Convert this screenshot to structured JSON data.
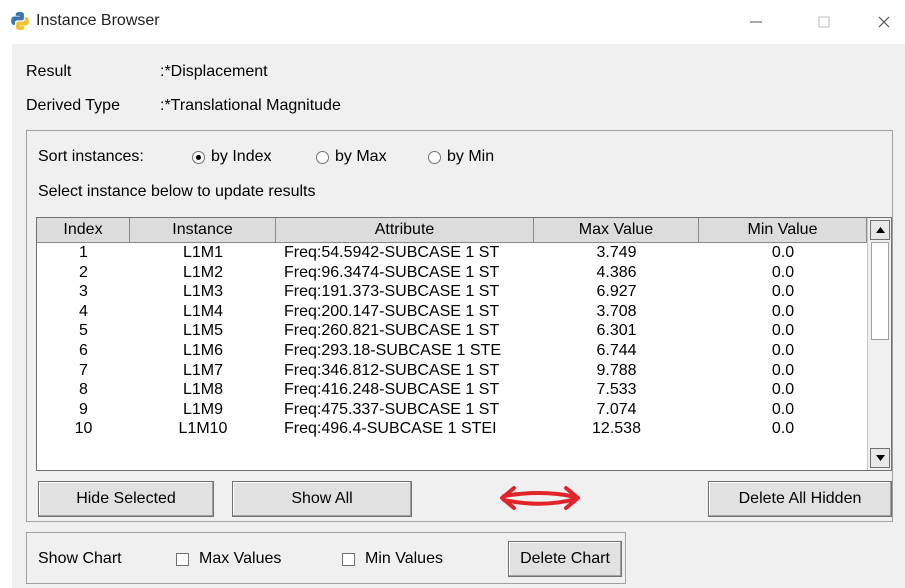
{
  "window": {
    "title": "Instance Browser",
    "icon": "python-icon"
  },
  "info": {
    "result_label": "Result",
    "result_value": ":*Displacement",
    "derived_label": "Derived Type",
    "derived_value": ":*Translational Magnitude"
  },
  "sort": {
    "label": "Sort instances:",
    "options": [
      "by Index",
      "by Max",
      "by Min"
    ],
    "selected": "by Index",
    "hint": "Select instance below to update results"
  },
  "table": {
    "columns": [
      "Index",
      "Instance",
      "Attribute",
      "Max Value",
      "Min Value"
    ],
    "rows": [
      [
        "1",
        "L1M1",
        "Freq:54.5942-SUBCASE 1 ST",
        "3.749",
        "0.0"
      ],
      [
        "2",
        "L1M2",
        "Freq:96.3474-SUBCASE 1 ST",
        "4.386",
        "0.0"
      ],
      [
        "3",
        "L1M3",
        "Freq:191.373-SUBCASE 1 ST",
        "6.927",
        "0.0"
      ],
      [
        "4",
        "L1M4",
        "Freq:200.147-SUBCASE 1 ST",
        "3.708",
        "0.0"
      ],
      [
        "5",
        "L1M5",
        "Freq:260.821-SUBCASE 1 ST",
        "6.301",
        "0.0"
      ],
      [
        "6",
        "L1M6",
        "Freq:293.18-SUBCASE 1 STE",
        "6.744",
        "0.0"
      ],
      [
        "7",
        "L1M7",
        "Freq:346.812-SUBCASE 1 ST",
        "9.788",
        "0.0"
      ],
      [
        "8",
        "L1M8",
        "Freq:416.248-SUBCASE 1 ST",
        "7.533",
        "0.0"
      ],
      [
        "9",
        "L1M9",
        "Freq:475.337-SUBCASE 1 ST",
        "7.074",
        "0.0"
      ],
      [
        "10",
        "L1M10",
        "Freq:496.4-SUBCASE 1 STEI",
        "12.538",
        "0.0"
      ]
    ]
  },
  "buttons": {
    "hide_selected": "Hide Selected",
    "show_all": "Show All",
    "delete_all_hidden": "Delete All Hidden",
    "delete_chart": "Delete Chart"
  },
  "chart": {
    "label": "Show Chart",
    "max_values": "Max Values",
    "min_values": "Min Values",
    "max_checked": false,
    "min_checked": false
  },
  "colors": {
    "annotation_arrow": "#e0242a",
    "header_bg": "#dcdcdc",
    "client_bg": "#f0f0f0"
  }
}
